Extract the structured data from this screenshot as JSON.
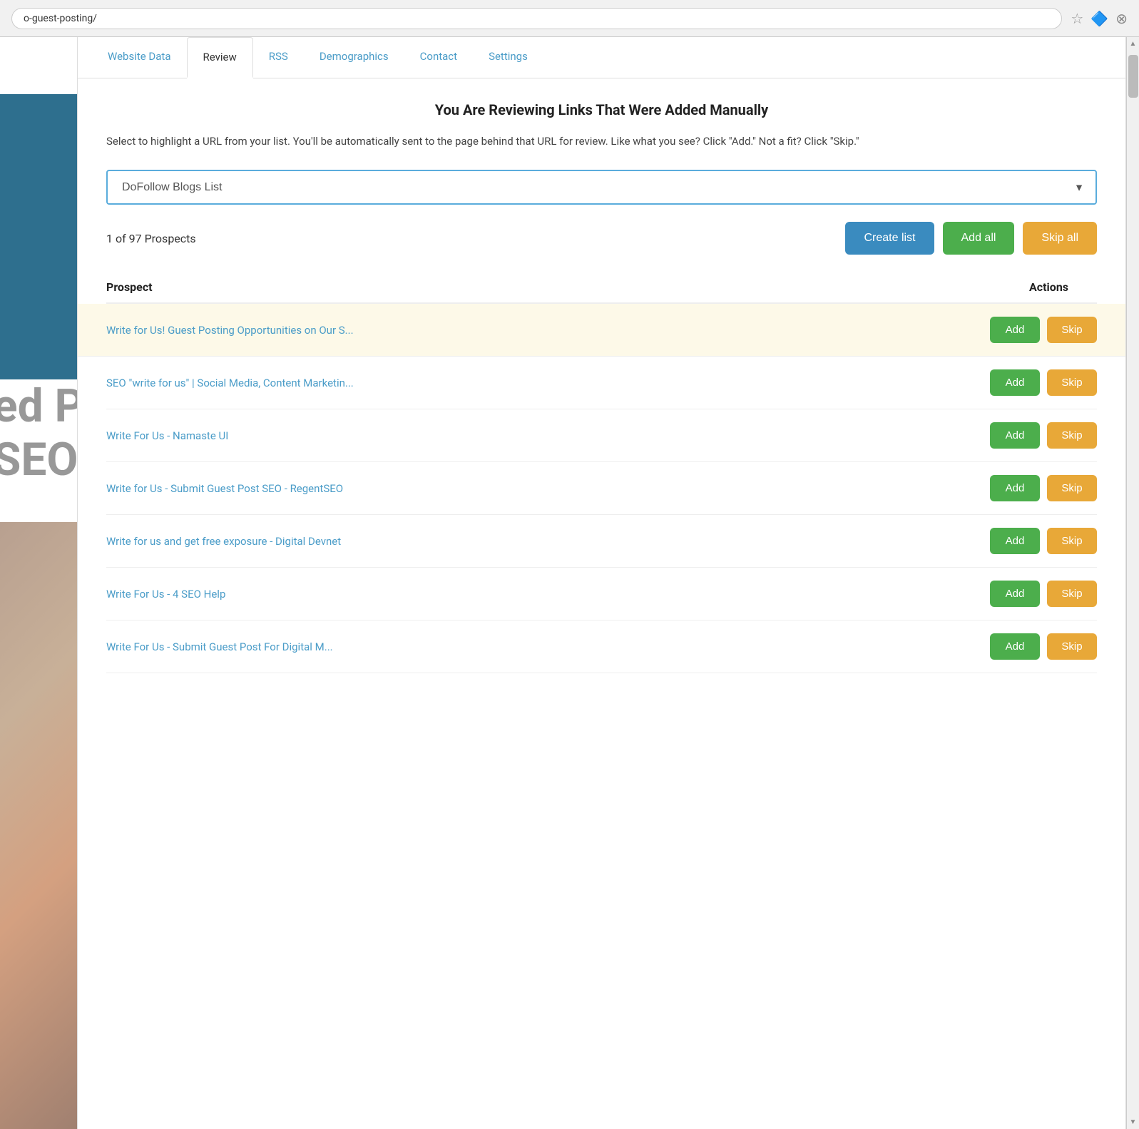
{
  "browser": {
    "url": "o-guest-posting/",
    "star_icon": "☆",
    "plugin_icon": "🔷",
    "close_icon": "⊗"
  },
  "tabs": [
    {
      "id": "website-data",
      "label": "Website Data",
      "active": false
    },
    {
      "id": "review",
      "label": "Review",
      "active": true
    },
    {
      "id": "rss",
      "label": "RSS",
      "active": false
    },
    {
      "id": "demographics",
      "label": "Demographics",
      "active": false
    },
    {
      "id": "contact",
      "label": "Contact",
      "active": false
    },
    {
      "id": "settings",
      "label": "Settings",
      "active": false
    }
  ],
  "review": {
    "title": "You Are Reviewing Links That Were Added Manually",
    "description": "Select to highlight a URL from your list. You'll be automatically sent to the page behind that URL for review. Like what you see? Click \"Add.\" Not a fit? Click \"Skip.\"",
    "dropdown": {
      "value": "DoFollow Blogs List",
      "options": [
        "DoFollow Blogs List"
      ]
    },
    "prospects_count": "1 of 97 Prospects",
    "buttons": {
      "create_list": "Create list",
      "add_all": "Add all",
      "skip_all": "Skip all"
    },
    "table": {
      "col_prospect": "Prospect",
      "col_actions": "Actions"
    },
    "rows": [
      {
        "id": 1,
        "label": "Write for Us! Guest Posting Opportunities on Our S...",
        "highlighted": true,
        "add_btn": "Add",
        "skip_btn": "Skip"
      },
      {
        "id": 2,
        "label": "SEO \"write for us\" | Social Media, Content Marketin...",
        "highlighted": false,
        "add_btn": "Add",
        "skip_btn": "Skip"
      },
      {
        "id": 3,
        "label": "Write For Us - Namaste UI",
        "highlighted": false,
        "add_btn": "Add",
        "skip_btn": "Skip"
      },
      {
        "id": 4,
        "label": "Write for Us - Submit Guest Post SEO - RegentSEO",
        "highlighted": false,
        "add_btn": "Add",
        "skip_btn": "Skip"
      },
      {
        "id": 5,
        "label": "Write for us and get free exposure - Digital Devnet",
        "highlighted": false,
        "add_btn": "Add",
        "skip_btn": "Skip"
      },
      {
        "id": 6,
        "label": "Write For Us - 4 SEO Help",
        "highlighted": false,
        "add_btn": "Add",
        "skip_btn": "Skip"
      },
      {
        "id": 7,
        "label": "Write For Us - Submit Guest Post For Digital M...",
        "highlighted": false,
        "add_btn": "Add",
        "skip_btn": "Skip"
      }
    ]
  }
}
